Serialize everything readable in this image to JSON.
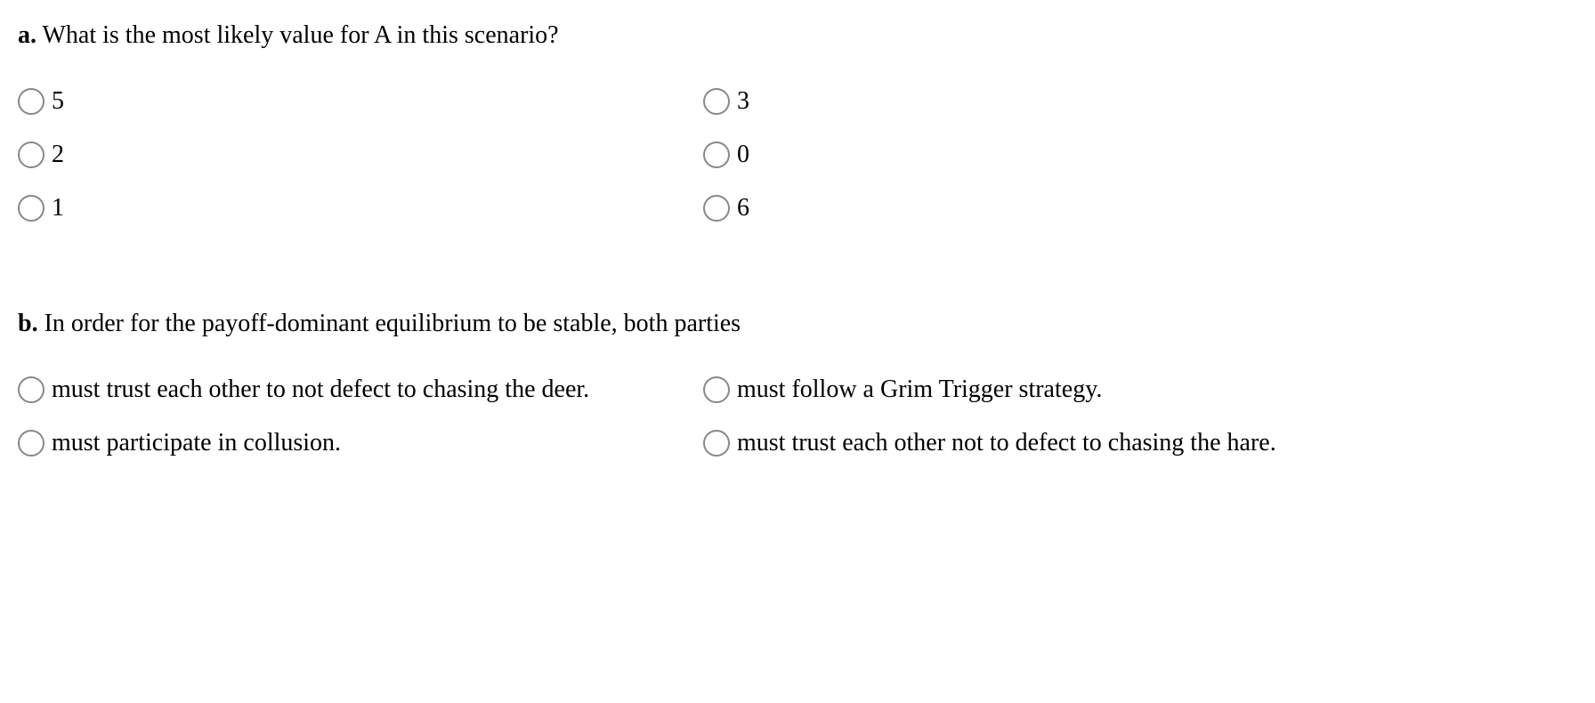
{
  "questions": [
    {
      "label": "a.",
      "text": "What is the most likely value for A in this scenario?",
      "options": [
        {
          "text": "5"
        },
        {
          "text": "3"
        },
        {
          "text": "2"
        },
        {
          "text": "0"
        },
        {
          "text": "1"
        },
        {
          "text": "6"
        }
      ]
    },
    {
      "label": "b.",
      "text": "In order for the payoff-dominant equilibrium to be stable, both parties",
      "options": [
        {
          "text": "must trust each other to not defect to chasing the deer."
        },
        {
          "text": "must follow a Grim Trigger strategy."
        },
        {
          "text": "must participate in collusion."
        },
        {
          "text": "must trust each other not to defect to chasing the hare."
        }
      ]
    }
  ]
}
